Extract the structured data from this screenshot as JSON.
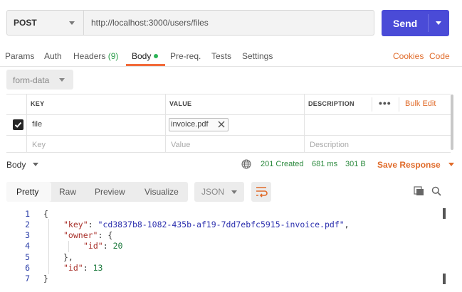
{
  "request": {
    "method": "POST",
    "url": "http://localhost:3000/users/files",
    "send_label": "Send"
  },
  "tabs": {
    "params": "Params",
    "auth": "Auth",
    "headers": "Headers",
    "headers_count": "(9)",
    "body": "Body",
    "prereq": "Pre-req.",
    "tests": "Tests",
    "settings": "Settings",
    "cookies": "Cookies",
    "code": "Code"
  },
  "body_type": "form-data",
  "table": {
    "headers": {
      "key": "KEY",
      "value": "VALUE",
      "description": "DESCRIPTION",
      "bulk_edit": "Bulk Edit"
    },
    "rows": [
      {
        "checked": true,
        "key": "file",
        "value_file": "invoice.pdf",
        "description": ""
      }
    ],
    "placeholders": {
      "key": "Key",
      "value": "Value",
      "description": "Description"
    }
  },
  "response": {
    "body_label": "Body",
    "status": "201 Created",
    "time": "681 ms",
    "size": "301 B",
    "save_label": "Save Response",
    "view_tabs": [
      "Pretty",
      "Raw",
      "Preview",
      "Visualize"
    ],
    "active_tab": "Pretty",
    "format": "JSON",
    "json": {
      "key_name": "\"key\"",
      "key_value": "\"cd3837b8-1082-435b-af19-7dd7ebfc5915-invoice.pdf\"",
      "owner_name": "\"owner\"",
      "owner_id_name": "\"id\"",
      "owner_id_value": "20",
      "id_name": "\"id\"",
      "id_value": "13"
    },
    "line_numbers": [
      "1",
      "2",
      "3",
      "4",
      "5",
      "6",
      "7"
    ]
  },
  "colors": {
    "accent": "#f26b3a",
    "send": "#4a4bd7",
    "status": "#2c8a3e"
  }
}
